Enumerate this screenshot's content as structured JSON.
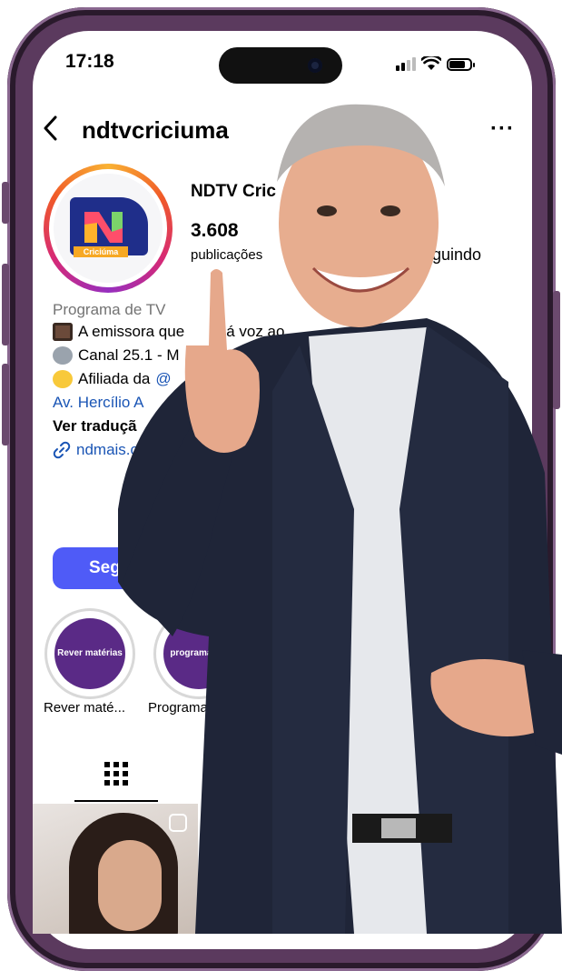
{
  "status_bar": {
    "time": "17:18"
  },
  "header": {
    "username": "ndtvcriciuma",
    "back_icon": "chevron-left-icon",
    "more_label": "···"
  },
  "profile": {
    "display_name": "NDTV Cric",
    "posts_count": "3.608",
    "posts_label": "publicações",
    "following_label": "guindo",
    "avatar_tag": "Criciúma"
  },
  "bio": {
    "category": "Programa de TV",
    "line1": "A emissora que",
    "line1b": "á voz ao",
    "line2": "Canal 25.1 - M",
    "line3": "Afiliada da",
    "line3b": "@",
    "address": "Av. Hercílio A",
    "translate": "Ver traduçã",
    "link": "ndmais.c"
  },
  "follow_button": {
    "label": "Seg"
  },
  "highlights": [
    {
      "cover_text": "Rever matérias",
      "label": "Rever maté..."
    },
    {
      "cover_text": "programação",
      "label": "Programa"
    }
  ],
  "colors": {
    "follow": "#4f5bf7",
    "link": "#1a55b5",
    "highlight": "#5a2a86",
    "frame": "#5b3a5e"
  }
}
